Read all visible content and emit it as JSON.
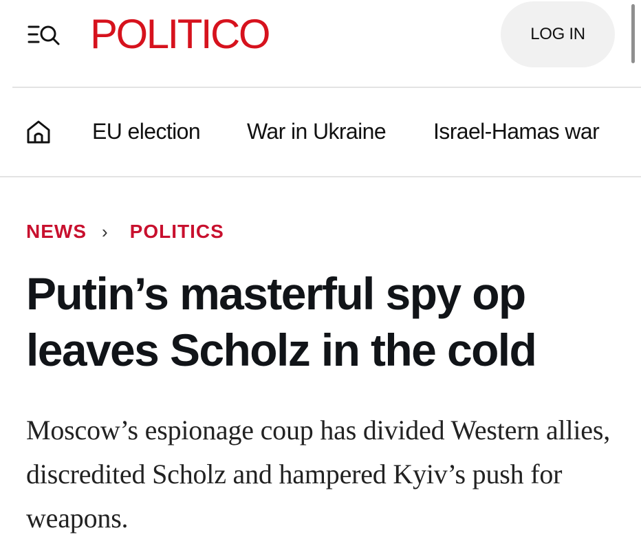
{
  "header": {
    "logo_text": "POLITICO",
    "logo_color": "#d6121d",
    "menu_icon": "menu-search-icon",
    "login_label": "LOG IN"
  },
  "nav": {
    "home_icon": "home-icon",
    "items": [
      {
        "label": "EU election"
      },
      {
        "label": "War in Ukraine"
      },
      {
        "label": "Israel-Hamas war"
      }
    ]
  },
  "article": {
    "breadcrumb": [
      "NEWS",
      "POLITICS"
    ],
    "breadcrumb_color": "#c8102e",
    "headline": "Putin’s masterful spy op leaves Scholz in the cold",
    "dek": "Moscow’s espionage coup has divided Western allies, discredited Scholz and hampered Kyiv’s push for weapons."
  }
}
